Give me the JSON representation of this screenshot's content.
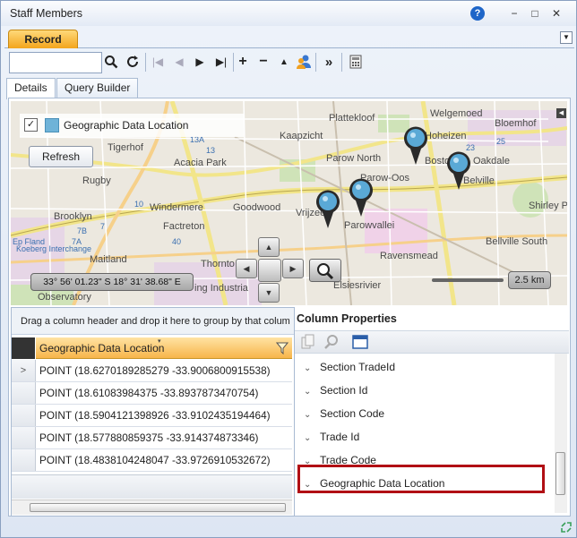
{
  "window": {
    "title": "Staff Members",
    "help_glyph": "?",
    "minimize_glyph": "−",
    "restore_glyph": "□",
    "close_glyph": "✕"
  },
  "ribbon": {
    "active_tab": "Record",
    "dropdown_glyph": "▼"
  },
  "toolbar": {
    "search_value": "",
    "search_icon": "magnifier-icon",
    "refresh_icon": "refresh-icon",
    "nav": [
      "|◀",
      "◀",
      "▶",
      "▶|"
    ],
    "add_glyph": "+",
    "remove_glyph": "−",
    "up_glyph": "▲",
    "more_glyph": "»"
  },
  "tabs": [
    {
      "label": "Details",
      "active": true
    },
    {
      "label": "Query Builder",
      "active": false
    }
  ],
  "map": {
    "layer_label": "Geographic Data Location",
    "layer_checked": "✓",
    "refresh_label": "Refresh",
    "coordinates": "33° 56' 01.23\" S 18° 31' 38.68\" E",
    "scale_label": "2.5 km",
    "places": [
      "Plattekloof",
      "Welgemoed",
      "Bloemhof",
      "Tigerhof",
      "Kaapzicht",
      "Hoheizen",
      "Acacia Park",
      "Parow North",
      "Boston",
      "Oakdale",
      "Rugby",
      "Parow-Oos",
      "Belville",
      "Windermere",
      "Goodwood",
      "Vrijzee",
      "Parowvallei",
      "Shirley Pa",
      "Brooklyn",
      "Factreton",
      "Bellville South",
      "Maitland",
      "Thornto",
      "Ravensmead",
      "Observatory",
      "ing Industria",
      "Elsiesrivier",
      "Koeberg Interchange",
      "Ep Fland"
    ],
    "road_labels": [
      "13A",
      "10",
      "7A",
      "7B",
      "7",
      "13",
      "23",
      "25",
      "40"
    ],
    "colors": {
      "land": "#ece8df",
      "water": "#9ecbe8",
      "road_major": "#f2e58a",
      "road_minor": "#ffffff",
      "park": "#cfe3b8",
      "industrial": "#e6d6e6",
      "pin": "#5aa9d6"
    }
  },
  "grid": {
    "group_hint": "Drag a column header and drop it here to group by that colum",
    "column": "Geographic Data Location",
    "rows": [
      "POINT (18.6270189285279 -33.9006800915538)",
      "POINT (18.61083984375 -33.8937873470754)",
      "POINT (18.5904121398926 -33.9102435194464)",
      "POINT (18.577880859375 -33.914374873346)",
      "POINT (18.4838104248047 -33.9726910532672)"
    ],
    "selected_row_indicator": ">"
  },
  "column_properties": {
    "title": "Column Properties",
    "items": [
      "Section TradeId",
      "Section Id",
      "Section Code",
      "Trade Id",
      "Trade Code",
      "Geographic Data Location"
    ],
    "highlighted": "Geographic Data Location",
    "highlight_color": "#b10f14"
  }
}
